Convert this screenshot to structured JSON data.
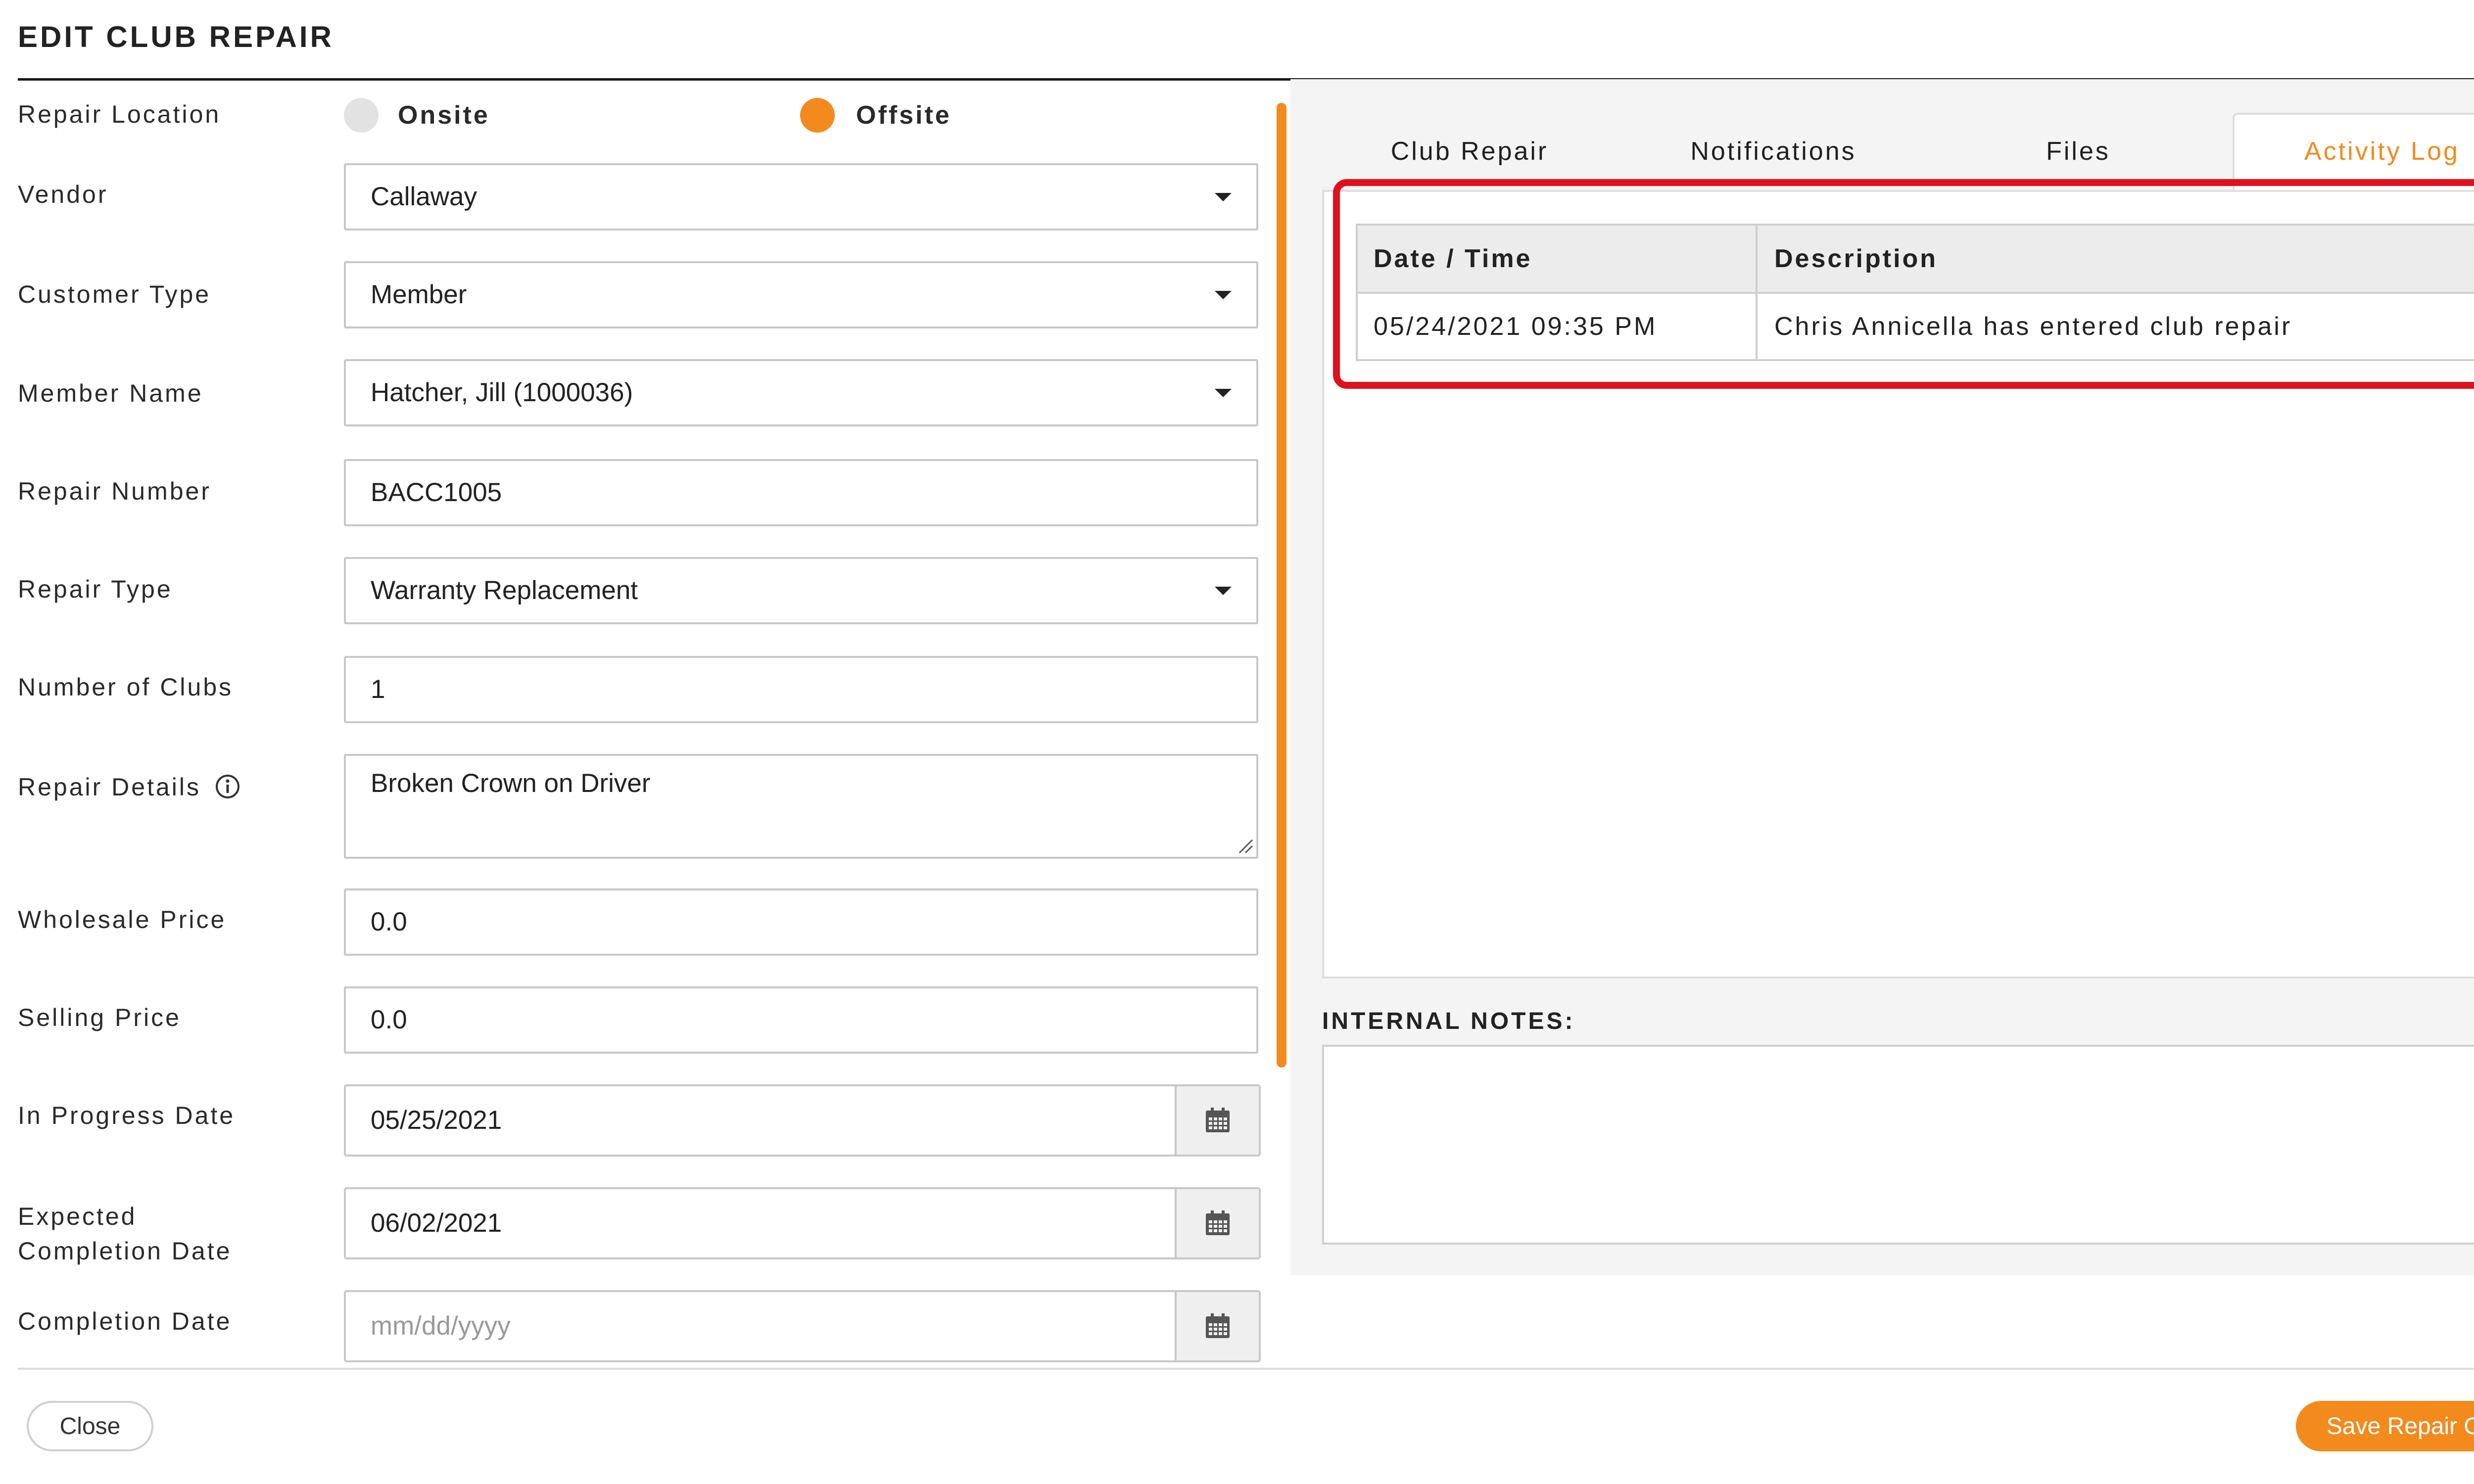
{
  "title": "EDIT CLUB REPAIR",
  "accent_color": "#f28a1e",
  "highlight_color": "#e0101f",
  "repair_location": {
    "label": "Repair Location",
    "options": [
      {
        "label": "Onsite",
        "selected": false
      },
      {
        "label": "Offsite",
        "selected": true
      }
    ]
  },
  "form": {
    "vendor": {
      "label": "Vendor",
      "value": "Callaway"
    },
    "customer_type": {
      "label": "Customer Type",
      "value": "Member"
    },
    "member_name": {
      "label": "Member Name",
      "value": "Hatcher, Jill (1000036)"
    },
    "repair_number": {
      "label": "Repair Number",
      "value": "BACC1005"
    },
    "repair_type": {
      "label": "Repair Type",
      "value": "Warranty Replacement"
    },
    "number_of_clubs": {
      "label": "Number of Clubs",
      "value": "1"
    },
    "repair_details": {
      "label": "Repair Details",
      "value": "Broken Crown on Driver"
    },
    "wholesale_price": {
      "label": "Wholesale Price",
      "value": "0.0"
    },
    "selling_price": {
      "label": "Selling Price",
      "value": "0.0"
    },
    "in_progress_date": {
      "label": "In Progress Date",
      "value": "05/25/2021"
    },
    "expected_completion_date": {
      "label_line1": "Expected",
      "label_line2": "Completion Date",
      "value": "06/02/2021"
    },
    "completion_date": {
      "label": "Completion Date",
      "placeholder": "mm/dd/yyyy"
    }
  },
  "tabs": [
    {
      "label": "Club Repair",
      "active": false
    },
    {
      "label": "Notifications",
      "active": false
    },
    {
      "label": "Files",
      "active": false
    },
    {
      "label": "Activity Log",
      "active": true
    }
  ],
  "activity_log": {
    "columns": [
      "Date / Time",
      "Description"
    ],
    "rows": [
      {
        "datetime": "05/24/2021 09:35 PM",
        "description": "Chris Annicella has entered club repair"
      }
    ]
  },
  "internal_notes": {
    "label": "INTERNAL NOTES:",
    "value": ""
  },
  "buttons": {
    "close": "Close",
    "save": "Save Repair Order"
  },
  "icons": {
    "info": "info-circle-icon",
    "calendar": "calendar-icon",
    "dropdown": "caret-down-icon"
  }
}
